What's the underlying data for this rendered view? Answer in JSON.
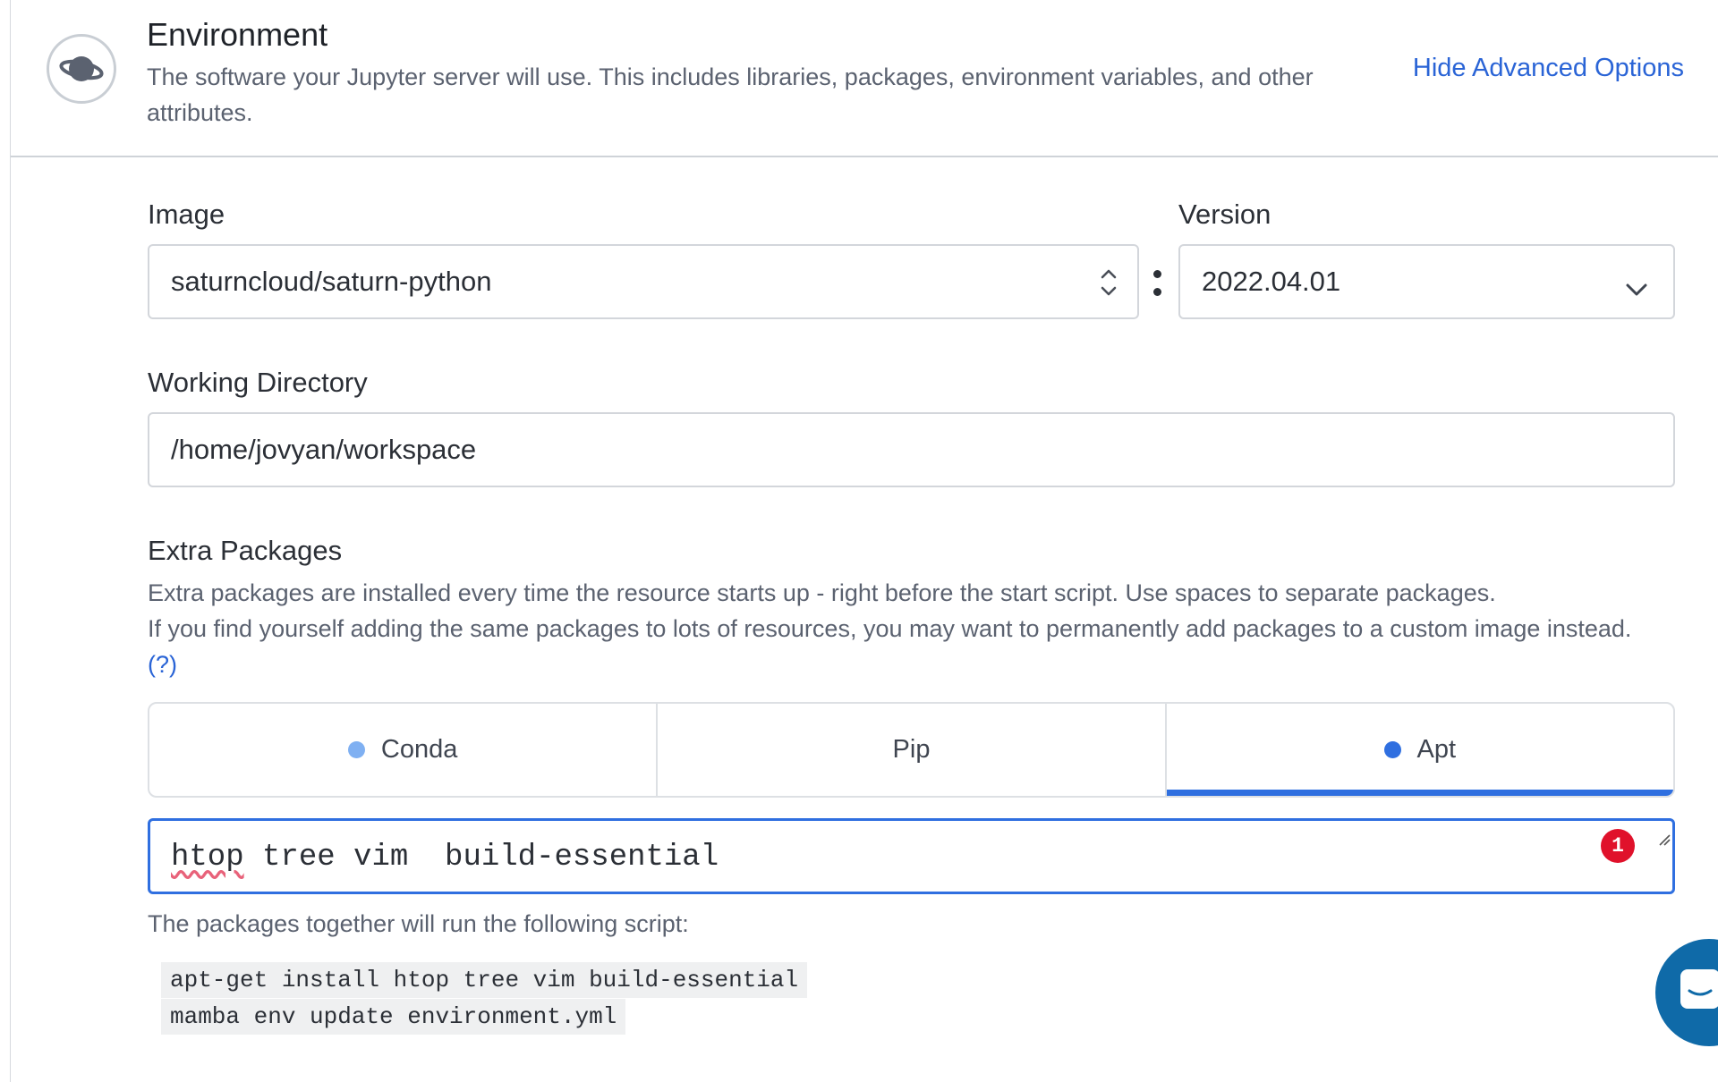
{
  "environment": {
    "title": "Environment",
    "description": "The software your Jupyter server will use. This includes libraries, packages, environment variables, and other attributes.",
    "hide_advanced_label": "Hide Advanced Options",
    "icon": "planet-icon"
  },
  "image": {
    "label": "Image",
    "value": "saturncloud/saturn-python"
  },
  "version": {
    "label": "Version",
    "value": "2022.04.01"
  },
  "working_directory": {
    "label": "Working Directory",
    "value": "/home/jovyan/workspace"
  },
  "extra_packages": {
    "title": "Extra Packages",
    "description_line1": "Extra packages are installed every time the resource starts up - right before the start script. Use spaces to separate packages.",
    "description_line2": "If you find yourself adding the same packages to lots of resources, you may want to permanently add packages to a custom image instead.",
    "help_link": "(?)",
    "tabs": [
      {
        "label": "Conda",
        "has_dot": true,
        "dot_color": "#7fb0f2",
        "active": false
      },
      {
        "label": "Pip",
        "has_dot": false,
        "active": false
      },
      {
        "label": "Apt",
        "has_dot": true,
        "dot_color": "#2f6fe0",
        "active": true
      }
    ],
    "input": {
      "word1": "htop",
      "rest": " tree vim  build-essential",
      "error_count": "1"
    },
    "script_intro": "The packages together will run the following script:",
    "script_lines": [
      "apt-get install htop tree vim build-essential",
      "mamba env update environment.yml"
    ]
  },
  "colors": {
    "accent": "#2f6fe0",
    "link": "#2a64d6",
    "error": "#e0112b",
    "chat": "#0f6aa8"
  }
}
